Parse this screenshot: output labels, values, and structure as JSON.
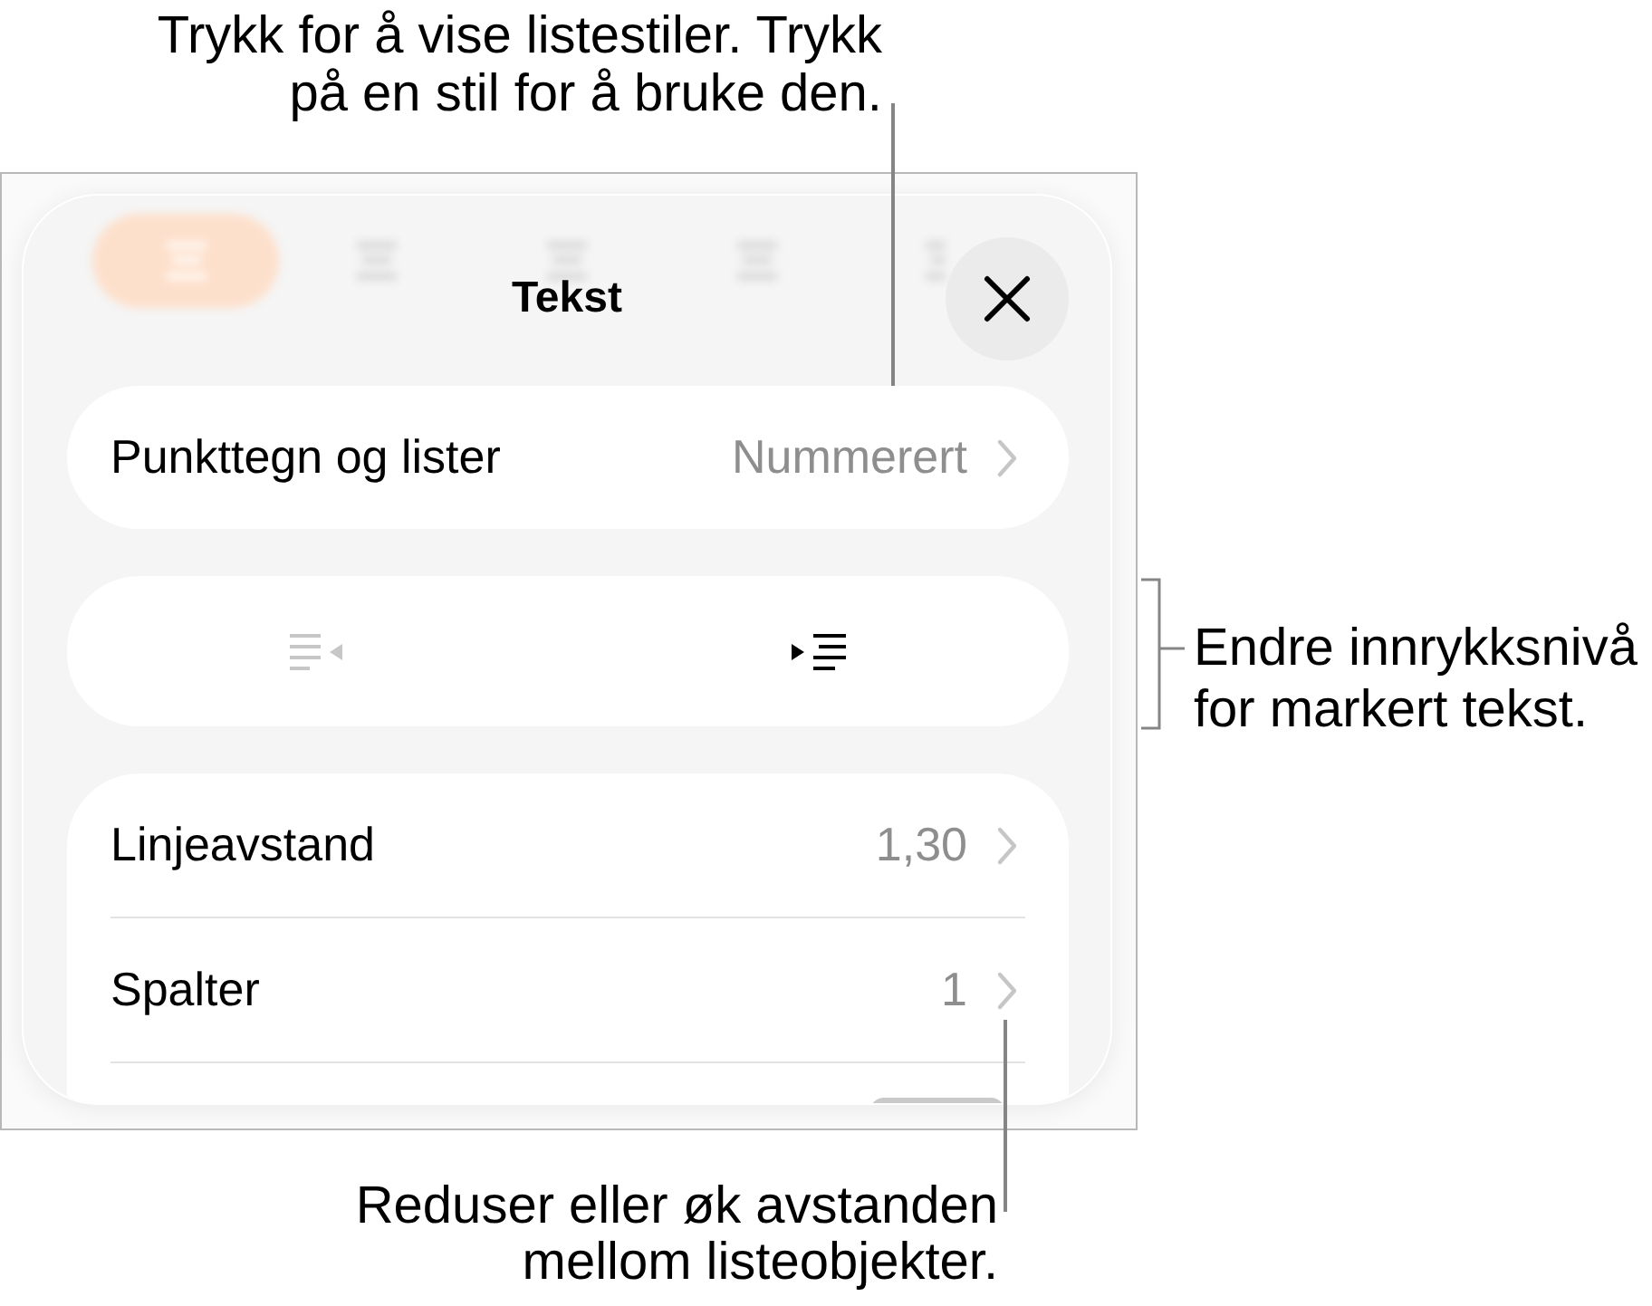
{
  "callouts": {
    "list_styles": {
      "lines": [
        "Trykk for å vise listestiler. Trykk",
        "på en stil for å bruke den."
      ]
    },
    "indent": {
      "lines": [
        "Endre innrykksnivå",
        "for markert tekst."
      ]
    },
    "spacing": {
      "lines": [
        "Reduser eller øk avstanden",
        "mellom listeobjekter."
      ]
    }
  },
  "sheet": {
    "toolbar": [
      {
        "selected": true
      },
      {
        "selected": false
      },
      {
        "selected": false
      },
      {
        "selected": false
      },
      {
        "selected": false
      }
    ],
    "title": "Tekst",
    "bullets_row": {
      "label": "Punkttegn og lister",
      "value": "Nummerert"
    },
    "indent_buttons": [
      {
        "kind": "decrease",
        "disabled": true
      },
      {
        "kind": "increase",
        "disabled": false
      }
    ],
    "rows": [
      {
        "label": "Linjeavstand",
        "value": "1,30"
      },
      {
        "label": "Spalter",
        "value": "1"
      }
    ]
  }
}
